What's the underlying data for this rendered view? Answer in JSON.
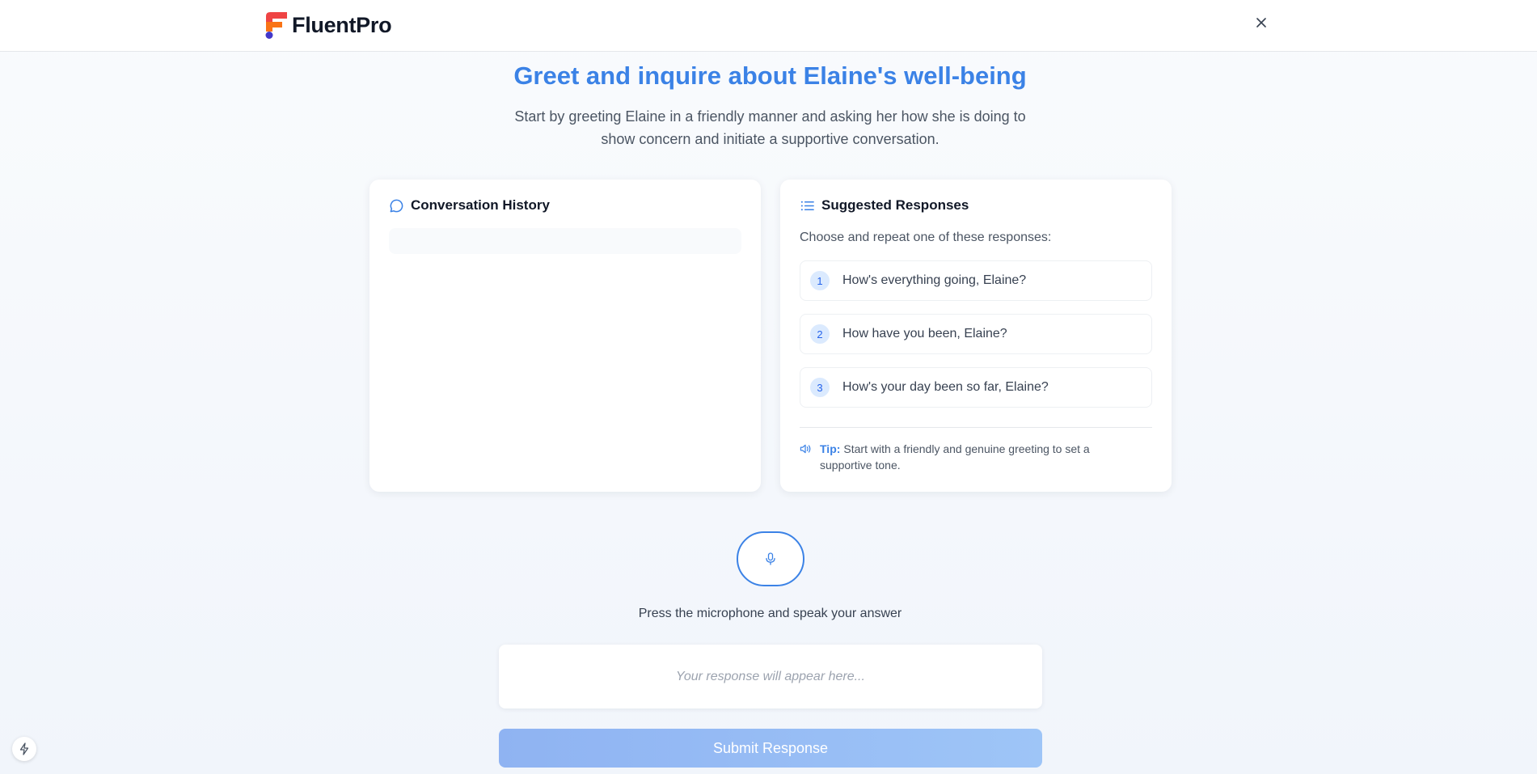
{
  "header": {
    "brand": "FluentPro",
    "close_icon": "close-icon",
    "logo_colors": {
      "flag_top": "#ef4444",
      "flag_bottom": "#f97316",
      "dot": "#4338ca"
    }
  },
  "task": {
    "title": "Greet and inquire about Elaine's well-being",
    "description": "Start by greeting Elaine in a friendly manner and asking her how she is doing to show concern and initiate a supportive conversation."
  },
  "history": {
    "title": "Conversation History",
    "icon": "chat-bubble-icon"
  },
  "suggestions": {
    "title": "Suggested Responses",
    "icon": "list-icon",
    "instruction": "Choose and repeat one of these responses:",
    "items": [
      {
        "num": "1",
        "text": "How's everything going, Elaine?"
      },
      {
        "num": "2",
        "text": "How have you been, Elaine?"
      },
      {
        "num": "3",
        "text": "How's your day been so far, Elaine?"
      }
    ],
    "tip_icon": "speaker-icon",
    "tip_label": "Tip:",
    "tip_text": "Start with a friendly and genuine greeting to set a supportive tone."
  },
  "recorder": {
    "mic_icon": "microphone-icon",
    "instruction": "Press the microphone and speak your answer",
    "response_placeholder": "Your response will appear here...",
    "submit_label": "Submit Response"
  },
  "corner": {
    "icon": "lightning-icon"
  },
  "colors": {
    "accent": "#3b82e6",
    "submit_disabled": "#94bcf5"
  }
}
